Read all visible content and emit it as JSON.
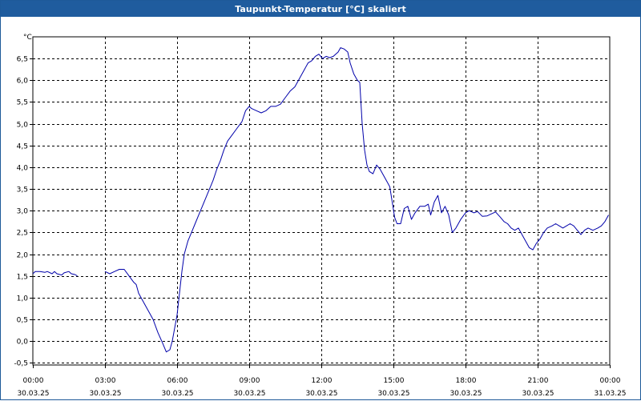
{
  "window": {
    "title": "Taupunkt-Temperatur [°C] skaliert"
  },
  "chart_data": {
    "type": "line",
    "title": "Taupunkt-Temperatur [°C] skaliert",
    "ylabel": "°C",
    "xlabel": "",
    "ylim": [
      -0.55,
      7.0
    ],
    "yticks": [
      "-0,5",
      "0,0",
      "0,5",
      "1,0",
      "1,5",
      "2,0",
      "2,5",
      "3,0",
      "3,5",
      "4,0",
      "4,5",
      "5,0",
      "5,5",
      "6,0",
      "6,5"
    ],
    "ytick_values": [
      -0.5,
      0,
      0.5,
      1.0,
      1.5,
      2.0,
      2.5,
      3.0,
      3.5,
      4.0,
      4.5,
      5.0,
      5.5,
      6.0,
      6.5
    ],
    "xlim_hours": [
      0,
      24
    ],
    "xticks": [
      {
        "hour": 0,
        "time": "00:00",
        "date": "30.03.25"
      },
      {
        "hour": 3,
        "time": "03:00",
        "date": "30.03.25"
      },
      {
        "hour": 6,
        "time": "06:00",
        "date": "30.03.25"
      },
      {
        "hour": 9,
        "time": "09:00",
        "date": "30.03.25"
      },
      {
        "hour": 12,
        "time": "12:00",
        "date": "30.03.25"
      },
      {
        "hour": 15,
        "time": "15:00",
        "date": "30.03.25"
      },
      {
        "hour": 18,
        "time": "18:00",
        "date": "30.03.25"
      },
      {
        "hour": 21,
        "time": "21:00",
        "date": "30.03.25"
      },
      {
        "hour": 24,
        "time": "00:00",
        "date": "31.03.25"
      }
    ],
    "grid": true,
    "line_color": "#0000aa",
    "series": [
      {
        "segments": [
          [
            [
              0.0,
              1.55
            ],
            [
              0.1,
              1.6
            ],
            [
              0.3,
              1.6
            ],
            [
              0.5,
              1.58
            ],
            [
              0.6,
              1.6
            ],
            [
              0.8,
              1.55
            ],
            [
              0.9,
              1.6
            ],
            [
              1.0,
              1.55
            ],
            [
              1.2,
              1.52
            ],
            [
              1.3,
              1.57
            ],
            [
              1.5,
              1.6
            ],
            [
              1.6,
              1.55
            ],
            [
              1.75,
              1.53
            ],
            [
              1.85,
              1.5
            ]
          ],
          [
            [
              3.0,
              1.6
            ],
            [
              3.2,
              1.55
            ],
            [
              3.4,
              1.6
            ],
            [
              3.6,
              1.65
            ],
            [
              3.8,
              1.65
            ],
            [
              4.0,
              1.5
            ],
            [
              4.2,
              1.35
            ],
            [
              4.3,
              1.3
            ],
            [
              4.4,
              1.1
            ],
            [
              4.6,
              0.9
            ],
            [
              4.8,
              0.7
            ],
            [
              5.0,
              0.5
            ],
            [
              5.2,
              0.2
            ],
            [
              5.4,
              -0.05
            ],
            [
              5.55,
              -0.25
            ],
            [
              5.7,
              -0.2
            ],
            [
              5.8,
              0.0
            ],
            [
              5.9,
              0.3
            ],
            [
              6.0,
              0.6
            ],
            [
              6.1,
              1.1
            ],
            [
              6.2,
              1.6
            ],
            [
              6.3,
              2.0
            ],
            [
              6.45,
              2.3
            ],
            [
              6.6,
              2.5
            ],
            [
              6.75,
              2.7
            ],
            [
              6.9,
              2.9
            ],
            [
              7.05,
              3.1
            ],
            [
              7.2,
              3.3
            ],
            [
              7.35,
              3.5
            ],
            [
              7.5,
              3.7
            ],
            [
              7.65,
              3.95
            ],
            [
              7.8,
              4.15
            ],
            [
              7.95,
              4.4
            ],
            [
              8.1,
              4.6
            ],
            [
              8.3,
              4.75
            ],
            [
              8.5,
              4.9
            ],
            [
              8.7,
              5.05
            ],
            [
              8.85,
              5.3
            ],
            [
              9.0,
              5.4
            ],
            [
              9.1,
              5.35
            ],
            [
              9.3,
              5.3
            ],
            [
              9.5,
              5.25
            ],
            [
              9.7,
              5.3
            ],
            [
              9.9,
              5.4
            ],
            [
              10.1,
              5.4
            ],
            [
              10.3,
              5.45
            ],
            [
              10.5,
              5.6
            ],
            [
              10.7,
              5.75
            ],
            [
              10.9,
              5.85
            ],
            [
              11.1,
              6.05
            ],
            [
              11.3,
              6.25
            ],
            [
              11.45,
              6.4
            ],
            [
              11.6,
              6.45
            ],
            [
              11.75,
              6.55
            ],
            [
              11.9,
              6.6
            ],
            [
              12.05,
              6.5
            ],
            [
              12.2,
              6.55
            ],
            [
              12.35,
              6.52
            ],
            [
              12.5,
              6.55
            ],
            [
              12.7,
              6.65
            ],
            [
              12.8,
              6.75
            ],
            [
              12.95,
              6.72
            ],
            [
              13.1,
              6.65
            ],
            [
              13.2,
              6.4
            ],
            [
              13.35,
              6.15
            ],
            [
              13.5,
              6.0
            ],
            [
              13.6,
              5.95
            ],
            [
              13.7,
              5.0
            ],
            [
              13.8,
              4.4
            ],
            [
              13.9,
              4.05
            ],
            [
              14.0,
              3.9
            ],
            [
              14.15,
              3.85
            ],
            [
              14.3,
              4.05
            ],
            [
              14.45,
              3.95
            ],
            [
              14.6,
              3.8
            ],
            [
              14.75,
              3.65
            ],
            [
              14.85,
              3.55
            ],
            [
              14.95,
              3.2
            ],
            [
              15.05,
              2.85
            ],
            [
              15.15,
              2.7
            ],
            [
              15.3,
              2.7
            ],
            [
              15.45,
              3.05
            ],
            [
              15.6,
              3.1
            ],
            [
              15.75,
              2.8
            ],
            [
              15.9,
              2.95
            ],
            [
              16.1,
              3.1
            ],
            [
              16.3,
              3.1
            ],
            [
              16.45,
              3.15
            ],
            [
              16.55,
              2.9
            ],
            [
              16.7,
              3.2
            ],
            [
              16.85,
              3.35
            ],
            [
              17.0,
              2.95
            ],
            [
              17.15,
              3.1
            ],
            [
              17.3,
              2.9
            ],
            [
              17.45,
              2.5
            ],
            [
              17.6,
              2.6
            ],
            [
              17.8,
              2.8
            ],
            [
              18.0,
              2.95
            ],
            [
              18.15,
              3.0
            ],
            [
              18.35,
              2.95
            ],
            [
              18.5,
              2.98
            ],
            [
              18.7,
              2.87
            ],
            [
              18.9,
              2.88
            ],
            [
              19.05,
              2.92
            ],
            [
              19.25,
              2.97
            ],
            [
              19.45,
              2.85
            ],
            [
              19.6,
              2.75
            ],
            [
              19.75,
              2.7
            ],
            [
              19.9,
              2.6
            ],
            [
              20.05,
              2.55
            ],
            [
              20.2,
              2.6
            ],
            [
              20.35,
              2.45
            ],
            [
              20.5,
              2.3
            ],
            [
              20.65,
              2.15
            ],
            [
              20.8,
              2.1
            ],
            [
              20.95,
              2.25
            ],
            [
              21.1,
              2.35
            ],
            [
              21.25,
              2.5
            ],
            [
              21.4,
              2.6
            ],
            [
              21.6,
              2.65
            ],
            [
              21.75,
              2.7
            ],
            [
              21.9,
              2.65
            ],
            [
              22.05,
              2.6
            ],
            [
              22.2,
              2.65
            ],
            [
              22.35,
              2.7
            ],
            [
              22.5,
              2.65
            ],
            [
              22.65,
              2.55
            ],
            [
              22.8,
              2.45
            ],
            [
              22.95,
              2.55
            ],
            [
              23.1,
              2.6
            ],
            [
              23.3,
              2.55
            ],
            [
              23.5,
              2.6
            ],
            [
              23.65,
              2.65
            ],
            [
              23.8,
              2.75
            ],
            [
              23.95,
              2.9
            ]
          ]
        ]
      }
    ]
  }
}
